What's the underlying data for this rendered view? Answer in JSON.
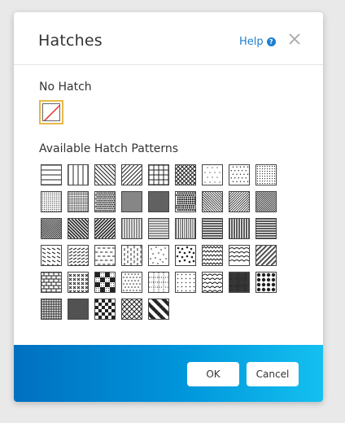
{
  "dialog": {
    "title": "Hatches",
    "help_label": "Help",
    "help_icon": "question-circle-icon",
    "close_icon": "close-icon",
    "no_hatch_label": "No Hatch",
    "available_label": "Available Hatch Patterns",
    "ok_label": "OK",
    "cancel_label": "Cancel"
  },
  "colors": {
    "accent": "#1f7fcf",
    "selection_border": "#e8b84a",
    "no_hatch_slash": "#e03030",
    "footer_gradient": [
      "#0070c0",
      "#0096db",
      "#14c0f0"
    ]
  },
  "patterns": [
    [
      "horizontal-lines-wide",
      "vertical-lines-wide",
      "diagonal-back-wide",
      "diagonal-fwd-wide",
      "grid",
      "diagonal-cross",
      "dots-sparse",
      "dots-medium",
      "dots-dense"
    ],
    [
      "stipple-fine",
      "stipple-medium",
      "stipple-dark",
      "stipple-darker",
      "stipple-darkest",
      "stipple-heavy",
      "diagonal-back-fine",
      "diagonal-fwd-fine",
      "diagonal-back-dense"
    ],
    [
      "diagonal-fwd-dense",
      "diagonal-back-bold",
      "diagonal-fwd-bold",
      "vertical-lines",
      "horizontal-lines",
      "vertical-lines-dense",
      "horizontal-lines-bold",
      "vertical-lines-bold",
      "horizontal-lines-thick"
    ],
    [
      "dashes-diagonal",
      "dashes-diagonal-2",
      "brick-dashes",
      "dashes-vertical",
      "sand",
      "gravel",
      "zigzag",
      "wave",
      "diagonal-double"
    ],
    [
      "brick",
      "crosshatch-dash",
      "checker-coarse",
      "dots-scattered",
      "grid-dotted",
      "dots-regular",
      "scales",
      "dense-mesh",
      "circles"
    ],
    [
      "fine-grid",
      "fine-mesh",
      "checkerboard",
      "diamond-lattice",
      "diamond-checker"
    ]
  ]
}
